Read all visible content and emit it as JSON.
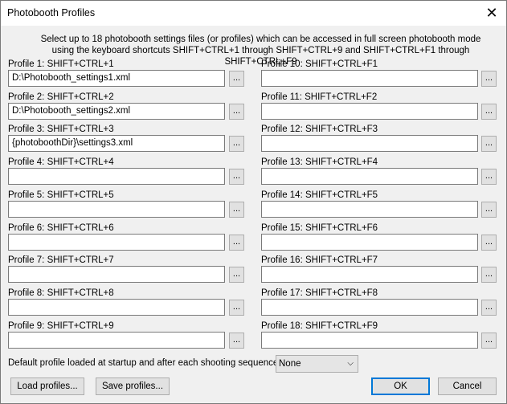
{
  "window": {
    "title": "Photobooth Profiles",
    "close_glyph": "✕"
  },
  "intro": "Select up to 18 photobooth settings files (or profiles) which can be accessed in full screen photobooth mode using the keyboard shortcuts SHIFT+CTRL+1 through SHIFT+CTRL+9 and SHIFT+CTRL+F1 through SHIFT+CTRL+F9",
  "browse_label": "...",
  "profiles": [
    {
      "label": "Profile 1: SHIFT+CTRL+1",
      "value": "D:\\Photobooth_settings1.xml"
    },
    {
      "label": "Profile 2: SHIFT+CTRL+2",
      "value": "D:\\Photobooth_settings2.xml"
    },
    {
      "label": "Profile 3: SHIFT+CTRL+3",
      "value": "{photoboothDir}\\settings3.xml"
    },
    {
      "label": "Profile 4: SHIFT+CTRL+4",
      "value": ""
    },
    {
      "label": "Profile 5: SHIFT+CTRL+5",
      "value": ""
    },
    {
      "label": "Profile 6: SHIFT+CTRL+6",
      "value": ""
    },
    {
      "label": "Profile 7: SHIFT+CTRL+7",
      "value": ""
    },
    {
      "label": "Profile 8: SHIFT+CTRL+8",
      "value": ""
    },
    {
      "label": "Profile 9: SHIFT+CTRL+9",
      "value": ""
    },
    {
      "label": "Profile 10: SHIFT+CTRL+F1",
      "value": ""
    },
    {
      "label": "Profile 11: SHIFT+CTRL+F2",
      "value": ""
    },
    {
      "label": "Profile 12: SHIFT+CTRL+F3",
      "value": ""
    },
    {
      "label": "Profile 13: SHIFT+CTRL+F4",
      "value": ""
    },
    {
      "label": "Profile 14: SHIFT+CTRL+F5",
      "value": ""
    },
    {
      "label": "Profile 15: SHIFT+CTRL+F6",
      "value": ""
    },
    {
      "label": "Profile 16: SHIFT+CTRL+F7",
      "value": ""
    },
    {
      "label": "Profile 17: SHIFT+CTRL+F8",
      "value": ""
    },
    {
      "label": "Profile 18: SHIFT+CTRL+F9",
      "value": ""
    }
  ],
  "default_profile": {
    "label": "Default profile loaded at startup and after each shooting sequence:",
    "selected": "None",
    "arrow_glyph": "⌵"
  },
  "buttons": {
    "load": "Load profiles...",
    "save": "Save profiles...",
    "ok": "OK",
    "cancel": "Cancel"
  }
}
